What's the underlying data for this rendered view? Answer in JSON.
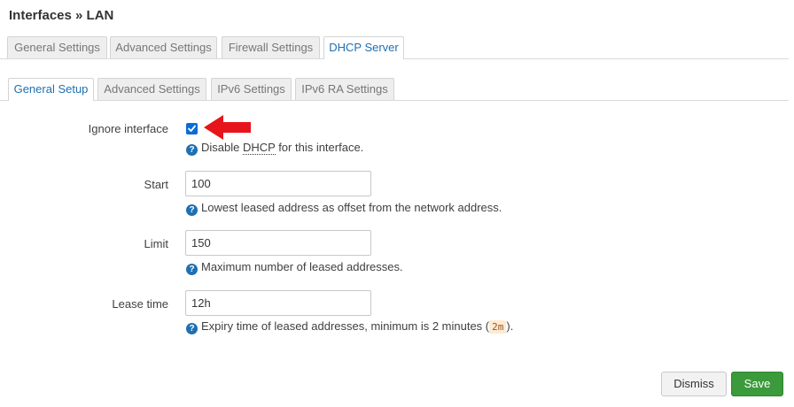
{
  "page": {
    "title": "Interfaces » LAN"
  },
  "primary_tabs": [
    "General Settings",
    "Advanced Settings",
    "Firewall Settings",
    "DHCP Server"
  ],
  "secondary_tabs": [
    "General Setup",
    "Advanced Settings",
    "IPv6 Settings",
    "IPv6 RA Settings"
  ],
  "form": {
    "ignore": {
      "label": "Ignore interface",
      "checked": true,
      "help_prefix": "Disable ",
      "help_abbr": "DHCP",
      "help_suffix": " for this interface."
    },
    "start": {
      "label": "Start",
      "value": "100",
      "help": "Lowest leased address as offset from the network address."
    },
    "limit": {
      "label": "Limit",
      "value": "150",
      "help": "Maximum number of leased addresses."
    },
    "leasetime": {
      "label": "Lease time",
      "value": "12h",
      "help_prefix": "Expiry time of leased addresses, minimum is 2 minutes (",
      "help_code": "2m",
      "help_suffix": ")."
    }
  },
  "buttons": {
    "dismiss": "Dismiss",
    "save": "Save"
  },
  "colors": {
    "accent": "#1f6fb2",
    "save": "#3b9a3b",
    "arrow": "#e8141b",
    "checkbox": "#0b6cd6"
  }
}
